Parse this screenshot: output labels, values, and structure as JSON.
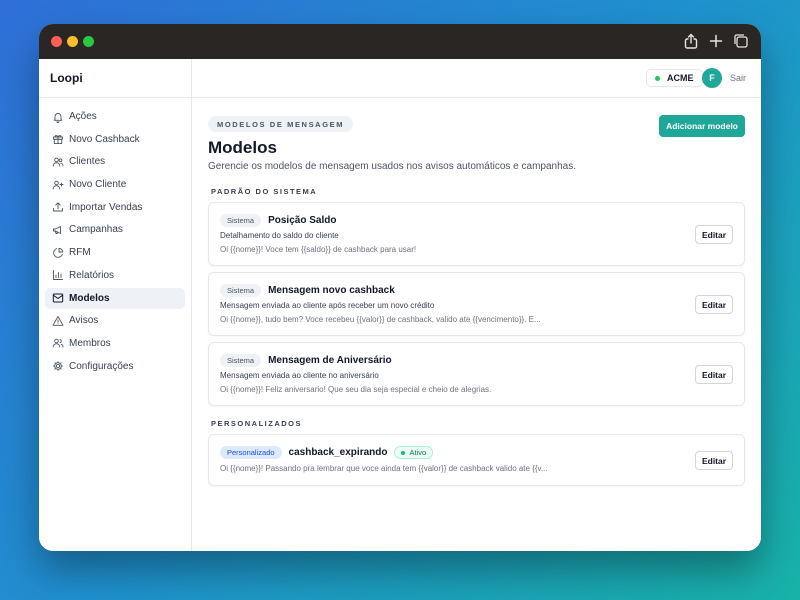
{
  "colors": {
    "accent": "#1fa89a",
    "org_dot": "#22c55e",
    "avatar": "#1fa89a"
  },
  "app": {
    "name": "Loopi"
  },
  "sidebar": {
    "items": [
      {
        "label": "Ações",
        "icon": "bell-icon"
      },
      {
        "label": "Novo Cashback",
        "icon": "gift-icon"
      },
      {
        "label": "Clientes",
        "icon": "users-icon"
      },
      {
        "label": "Novo Cliente",
        "icon": "user-plus-icon"
      },
      {
        "label": "Importar Vendas",
        "icon": "upload-icon"
      },
      {
        "label": "Campanhas",
        "icon": "megaphone-icon"
      },
      {
        "label": "RFM",
        "icon": "pie-chart-icon"
      },
      {
        "label": "Relatórios",
        "icon": "bar-chart-icon"
      },
      {
        "label": "Modelos",
        "icon": "message-icon",
        "active": true
      },
      {
        "label": "Avisos",
        "icon": "alert-triangle-icon"
      },
      {
        "label": "Membros",
        "icon": "members-icon"
      },
      {
        "label": "Configurações",
        "icon": "gear-icon"
      }
    ]
  },
  "topbar": {
    "org": "ACME",
    "avatar_initial": "F",
    "logout": "Sair"
  },
  "page": {
    "eyebrow": "MODELOS DE MENSAGEM",
    "title": "Modelos",
    "description": "Gerencie os modelos de mensagem usados nos avisos automáticos e campanhas.",
    "add_button": "Adicionar modelo"
  },
  "sections": {
    "system": {
      "label": "PADRÃO DO SISTEMA",
      "cards": [
        {
          "badge": "Sistema",
          "name": "Posição Saldo",
          "description": "Detalhamento do saldo do cliente",
          "preview": "Oi {{nome}}! Voce tem {{saldo}} de cashback para usar!",
          "edit": "Editar"
        },
        {
          "badge": "Sistema",
          "name": "Mensagem novo cashback",
          "description": "Mensagem enviada ao cliente após receber um novo crédito",
          "preview": "Oi {{nome}}, tudo bem? Voce recebeu {{valor}} de cashback, valido ate {{vencimento}}. E...",
          "edit": "Editar"
        },
        {
          "badge": "Sistema",
          "name": "Mensagem de Aniversário",
          "description": "Mensagem enviada ao cliente no aniversário",
          "preview": "Oi {{nome}}! Feliz aniversario! Que seu dia seja especial e cheio de alegrias.",
          "edit": "Editar"
        }
      ]
    },
    "custom": {
      "label": "PERSONALIZADOS",
      "cards": [
        {
          "badge": "Personalizado",
          "name": "cashback_expirando",
          "status": "Ativo",
          "preview": "Oi {{nome}}! Passando pra lembrar que voce ainda tem {{valor}} de cashback valido ate {{v...",
          "edit": "Editar"
        }
      ]
    }
  }
}
